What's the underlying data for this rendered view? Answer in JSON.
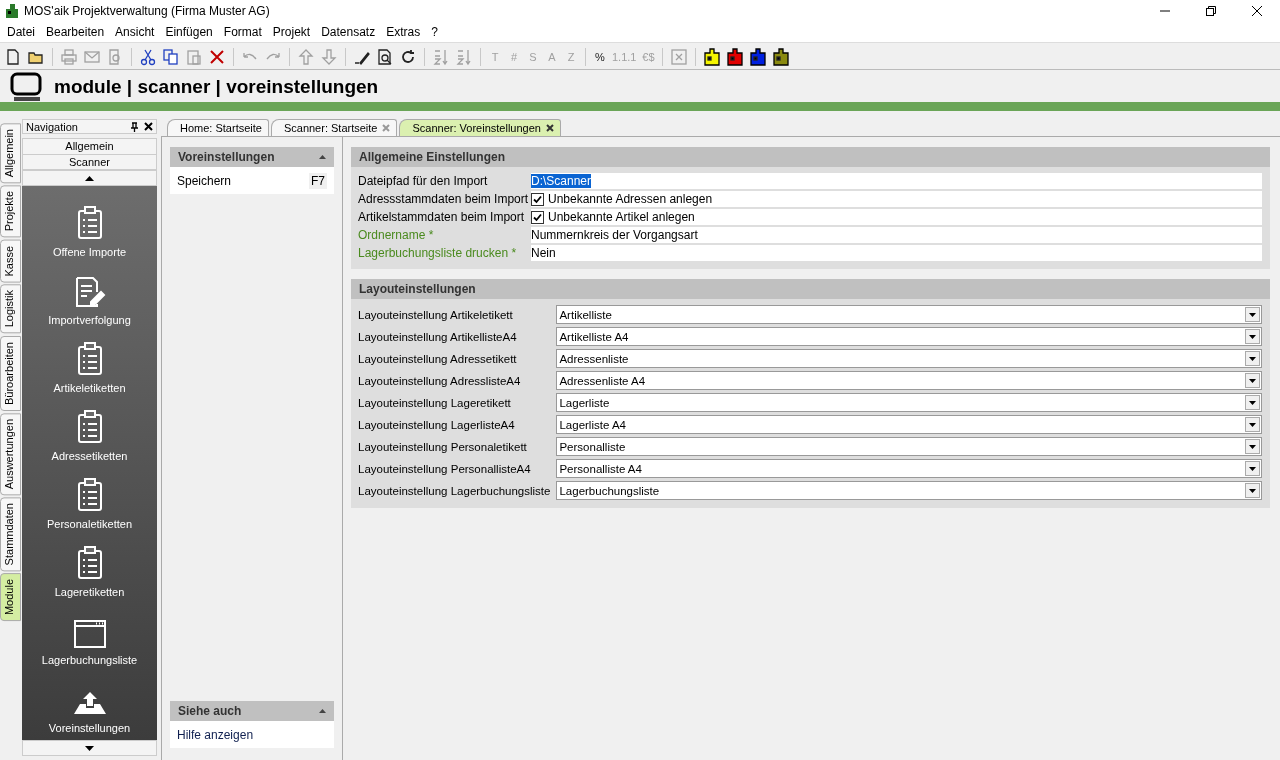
{
  "window": {
    "title": "MOS'aik Projektverwaltung (Firma Muster AG)"
  },
  "menu": [
    "Datei",
    "Bearbeiten",
    "Ansicht",
    "Einfügen",
    "Format",
    "Projekt",
    "Datensatz",
    "Extras",
    "?"
  ],
  "toolbar": [
    [
      {
        "kind": "new",
        "disabled": false
      },
      {
        "kind": "open",
        "disabled": false
      }
    ],
    [
      {
        "kind": "print",
        "disabled": true
      },
      {
        "kind": "mail",
        "disabled": true
      },
      {
        "kind": "preview",
        "disabled": true
      }
    ],
    [
      {
        "kind": "cut",
        "disabled": false
      },
      {
        "kind": "copy",
        "disabled": false
      },
      {
        "kind": "paste",
        "disabled": true
      },
      {
        "kind": "delete",
        "disabled": false
      }
    ],
    [
      {
        "kind": "undo",
        "disabled": true
      },
      {
        "kind": "redo",
        "disabled": true
      }
    ],
    [
      {
        "kind": "up",
        "disabled": true
      },
      {
        "kind": "down",
        "disabled": true
      }
    ],
    [
      {
        "kind": "pencil",
        "disabled": false
      },
      {
        "kind": "find",
        "disabled": false
      },
      {
        "kind": "refresh",
        "disabled": false
      }
    ],
    [
      {
        "kind": "sort",
        "disabled": true
      },
      {
        "kind": "sort",
        "disabled": true
      }
    ],
    [
      {
        "kind": "glyph",
        "label": "T",
        "disabled": true
      },
      {
        "kind": "glyph",
        "label": "#",
        "disabled": true
      },
      {
        "kind": "glyph",
        "label": "S",
        "disabled": true
      },
      {
        "kind": "glyph",
        "label": "A",
        "disabled": true
      },
      {
        "kind": "glyph",
        "label": "Z",
        "disabled": true
      }
    ],
    [
      {
        "kind": "glyph",
        "label": "%",
        "disabled": false
      },
      {
        "kind": "glyph",
        "label": "1.1.1",
        "disabled": true
      },
      {
        "kind": "glyph",
        "label": "€$",
        "disabled": true
      }
    ],
    [
      {
        "kind": "sheet",
        "disabled": true
      }
    ],
    [
      {
        "kind": "puzzle",
        "color": "#f5f500",
        "disabled": false
      },
      {
        "kind": "puzzle",
        "color": "#e00000",
        "disabled": false
      },
      {
        "kind": "puzzle",
        "color": "#0020e0",
        "disabled": false
      },
      {
        "kind": "puzzle",
        "color": "#8a8a10",
        "disabled": false
      }
    ]
  ],
  "header": {
    "title": "module | scanner | voreinstellungen"
  },
  "side_tabs": [
    {
      "label": "Allgemein",
      "selected": false
    },
    {
      "label": "Projekte",
      "selected": false
    },
    {
      "label": "Kasse",
      "selected": false
    },
    {
      "label": "Logistik",
      "selected": false
    },
    {
      "label": "Büroarbeiten",
      "selected": false
    },
    {
      "label": "Auswertungen",
      "selected": false
    },
    {
      "label": "Stammdaten",
      "selected": false
    },
    {
      "label": "Module",
      "selected": true
    }
  ],
  "navigation": {
    "title": "Navigation",
    "sections": [
      "Allgemein",
      "Scanner"
    ],
    "items": [
      {
        "label": "Offene Importe",
        "kind": "clipboard"
      },
      {
        "label": "Importverfolgung",
        "kind": "edit"
      },
      {
        "label": "Artikeletiketten",
        "kind": "clipboard"
      },
      {
        "label": "Adressetiketten",
        "kind": "clipboard"
      },
      {
        "label": "Personaletiketten",
        "kind": "clipboard"
      },
      {
        "label": "Lageretiketten",
        "kind": "clipboard"
      },
      {
        "label": "Lagerbuchungsliste",
        "kind": "window"
      },
      {
        "label": "Voreinstellungen",
        "kind": "upload"
      }
    ]
  },
  "tabs": [
    {
      "label": "Home: Startseite",
      "selected": false,
      "closable": false
    },
    {
      "label": "Scanner: Startseite",
      "selected": false,
      "closable": true
    },
    {
      "label": "Scanner: Voreinstellungen",
      "selected": true,
      "closable": true
    }
  ],
  "tasks": {
    "title": "Voreinstellungen",
    "items": [
      {
        "label": "Speichern",
        "shortcut": "F7"
      }
    ]
  },
  "see_also": {
    "title": "Siehe auch",
    "items": [
      "Hilfe anzeigen"
    ]
  },
  "general": {
    "title": "Allgemeine Einstellungen",
    "rows": [
      {
        "label": "Dateipfad für den Import",
        "kind": "text",
        "value": "D:\\Scanner",
        "required": false,
        "selected": true
      },
      {
        "label": "Adressstammdaten beim Import",
        "kind": "checkbox",
        "value": "Unbekannte Adressen anlegen",
        "checked": true,
        "required": false
      },
      {
        "label": "Artikelstammdaten beim Import",
        "kind": "checkbox",
        "value": "Unbekannte Artikel anlegen",
        "checked": true,
        "required": false
      },
      {
        "label": "Ordnername *",
        "kind": "text",
        "value": "Nummernkreis der Vorgangsart",
        "required": true,
        "selected": false
      },
      {
        "label": "Lagerbuchungsliste drucken *",
        "kind": "text",
        "value": "Nein",
        "required": true,
        "selected": false
      }
    ]
  },
  "layout": {
    "title": "Layouteinstellungen",
    "rows": [
      {
        "label": "Layouteinstellung Artikeletikett",
        "value": "Artikelliste"
      },
      {
        "label": "Layouteinstellung ArtikellisteA4",
        "value": "Artikelliste A4"
      },
      {
        "label": "Layouteinstellung Adressetikett",
        "value": "Adressenliste"
      },
      {
        "label": "Layouteinstellung AdresslisteA4",
        "value": "Adressenliste A4"
      },
      {
        "label": "Layouteinstellung Lageretikett",
        "value": "Lagerliste"
      },
      {
        "label": "Layouteinstellung LagerlisteA4",
        "value": "Lagerliste A4"
      },
      {
        "label": "Layouteinstellung Personaletikett",
        "value": "Personalliste"
      },
      {
        "label": "Layouteinstellung PersonallisteA4",
        "value": "Personalliste A4"
      },
      {
        "label": "Layouteinstellung Lagerbuchungsliste",
        "value": "Lagerbuchungsliste"
      }
    ]
  }
}
